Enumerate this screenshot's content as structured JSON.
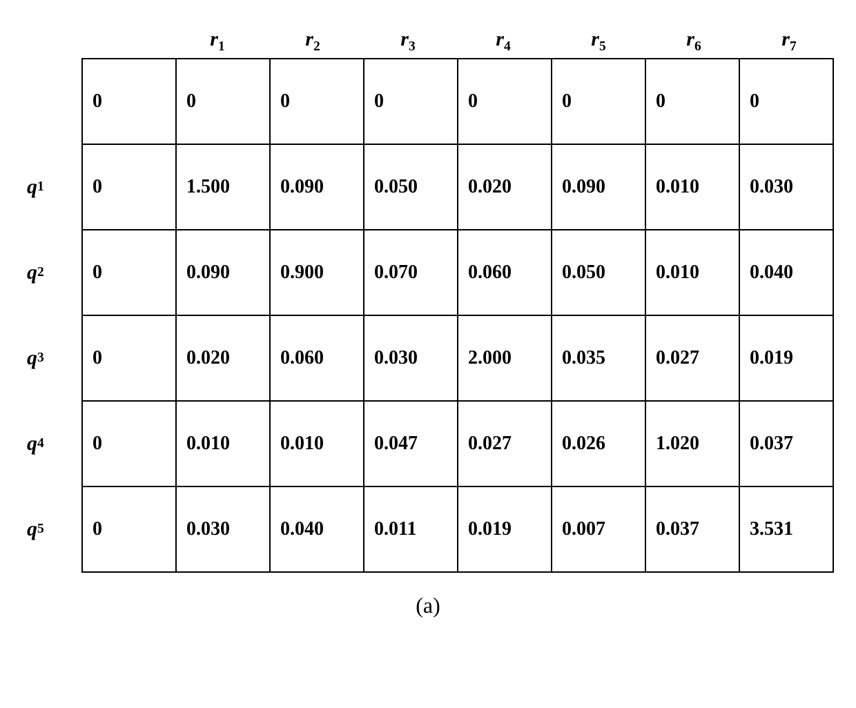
{
  "chart_data": {
    "type": "table",
    "title": "",
    "caption": "(a)",
    "col_var": "r",
    "row_var": "q",
    "col_indices": [
      1,
      2,
      3,
      4,
      5,
      6,
      7
    ],
    "row_indices": [
      1,
      2,
      3,
      4,
      5
    ],
    "rows": [
      [
        "0",
        "0",
        "0",
        "0",
        "0",
        "0",
        "0",
        "0"
      ],
      [
        "0",
        "1.500",
        "0.090",
        "0.050",
        "0.020",
        "0.090",
        "0.010",
        "0.030"
      ],
      [
        "0",
        "0.090",
        "0.900",
        "0.070",
        "0.060",
        "0.050",
        "0.010",
        "0.040"
      ],
      [
        "0",
        "0.020",
        "0.060",
        "0.030",
        "2.000",
        "0.035",
        "0.027",
        "0.019"
      ],
      [
        "0",
        "0.010",
        "0.010",
        "0.047",
        "0.027",
        "0.026",
        "1.020",
        "0.037"
      ],
      [
        "0",
        "0.030",
        "0.040",
        "0.011",
        "0.019",
        "0.007",
        "0.037",
        "3.531"
      ]
    ]
  }
}
